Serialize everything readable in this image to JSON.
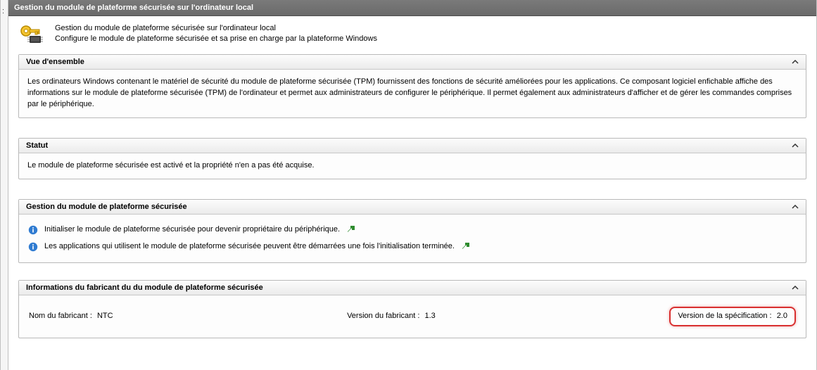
{
  "window": {
    "title": "Gestion du module de plateforme sécurisée sur l'ordinateur local"
  },
  "header": {
    "title": "Gestion du module de plateforme sécurisée sur l'ordinateur local",
    "subtitle": "Configure le module de plateforme sécurisée et sa prise en charge par la plateforme Windows"
  },
  "panels": {
    "overview": {
      "title": "Vue d'ensemble",
      "body": "Les ordinateurs Windows contenant le matériel de sécurité du module de plateforme sécurisée (TPM) fournissent des fonctions de sécurité améliorées pour les applications. Ce composant logiciel enfichable affiche des informations sur le module de plateforme sécurisée (TPM) de l'ordinateur et permet aux administrateurs de configurer le périphérique. Il permet également aux administrateurs d'afficher et de gérer les commandes comprises par le périphérique."
    },
    "status": {
      "title": "Statut",
      "body": "Le module de plateforme sécurisée est activé et la propriété n'en a pas été acquise."
    },
    "management": {
      "title": "Gestion du module de plateforme sécurisée",
      "line1": "Initialiser le module de plateforme sécurisée pour devenir propriétaire du périphérique.",
      "line2": "Les applications qui utilisent le module de plateforme sécurisée peuvent être démarrées une fois l'initialisation terminée."
    },
    "manufacturer": {
      "title": "Informations du fabricant du du module de plateforme sécurisée",
      "vendor_label": "Nom du fabricant :",
      "vendor_value": "NTC",
      "version_label": "Version du fabricant :",
      "version_value": "1.3",
      "spec_label": "Version de la spécification :",
      "spec_value": "2.0"
    }
  }
}
